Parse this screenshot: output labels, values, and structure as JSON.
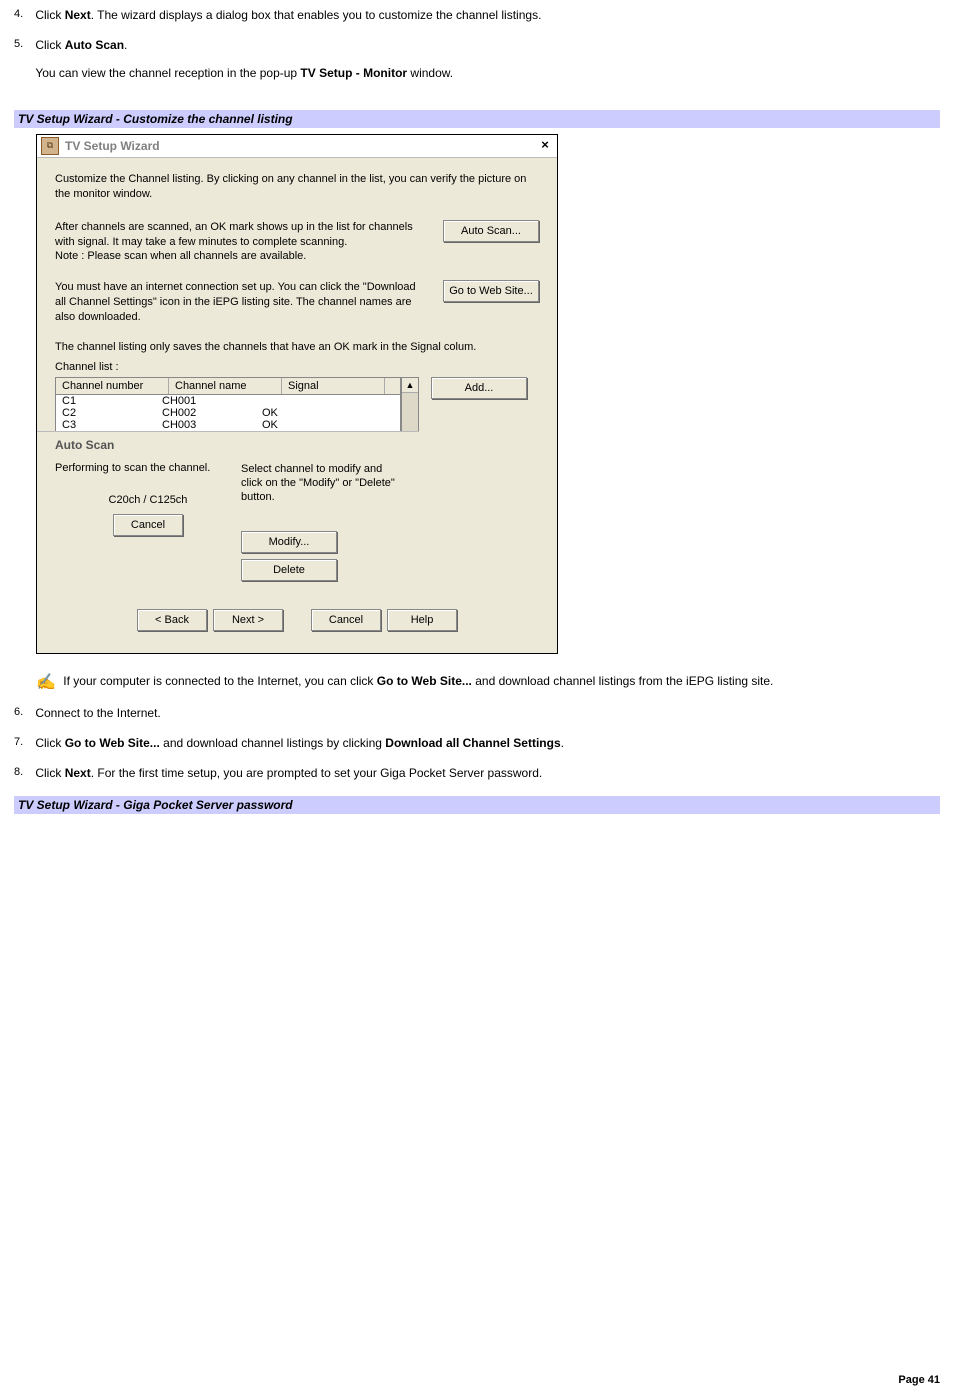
{
  "steps": {
    "s4": {
      "num": "4.",
      "pre": "Click ",
      "bold": "Next",
      "post": ". The wizard displays a dialog box that enables you to customize the channel listings."
    },
    "s5": {
      "num": "5.",
      "pre": "Click ",
      "bold": "Auto Scan",
      "post": ".",
      "sub_pre": "You can view the channel reception in the pop-up ",
      "sub_bold": "TV Setup - Monitor",
      "sub_post": " window."
    },
    "s6": {
      "num": "6.",
      "text": "Connect to the Internet."
    },
    "s7": {
      "num": "7.",
      "pre": "Click ",
      "bold1": "Go to Web Site...",
      "mid": " and download channel listings by clicking ",
      "bold2": "Download all Channel Settings",
      "post": "."
    },
    "s8": {
      "num": "8.",
      "pre": "Click ",
      "bold": "Next",
      "post": ". For the first time setup, you are prompted to set your Giga Pocket Server password."
    }
  },
  "heading1": "TV Setup Wizard - Customize the channel listing",
  "heading2": "TV Setup Wizard - Giga Pocket Server password",
  "note": {
    "pre": "If your computer is connected to the Internet, you can click ",
    "bold": "Go to Web Site...",
    "post": " and download channel listings from the iEPG listing site."
  },
  "page_label": "Page 41",
  "dialog": {
    "title": "TV Setup Wizard",
    "close": "×",
    "desc": "Customize the Channel listing. By clicking on any channel in the list, you can verify the picture on the monitor window.",
    "scan_text": "After channels are scanned, an OK mark shows up in the list for channels with signal. It may take a few minutes to complete scanning.\nNote : Please scan when all channels are available.",
    "web_text": "You must have an internet connection set up. You can click the \"Download all Channel Settings\" icon in the iEPG listing site. The channel names are also downloaded.",
    "save_note": "The channel listing only saves the channels that have an OK mark in the Signal colum.",
    "list_label": "Channel list :",
    "cols": {
      "num": "Channel number",
      "name": "Channel name",
      "sig": "Signal"
    },
    "rows": [
      {
        "num": "C1",
        "name": "CH001",
        "sig": ""
      },
      {
        "num": "C2",
        "name": "CH002",
        "sig": "OK"
      },
      {
        "num": "C3",
        "name": "CH003",
        "sig": "OK"
      }
    ],
    "buttons": {
      "autoscan": "Auto Scan...",
      "gotoweb": "Go to Web Site...",
      "add": "Add...",
      "modify": "Modify...",
      "delete": "Delete",
      "back": "< Back",
      "next": "Next >",
      "cancel": "Cancel",
      "help": "Help"
    },
    "side_hint": "Select channel to modify and click on the \"Modify\" or \"Delete\" button.",
    "autoscan_panel": {
      "title": "Auto Scan",
      "status": "Performing to scan the channel.",
      "progress": "C20ch / C125ch",
      "cancel": "Cancel"
    }
  }
}
